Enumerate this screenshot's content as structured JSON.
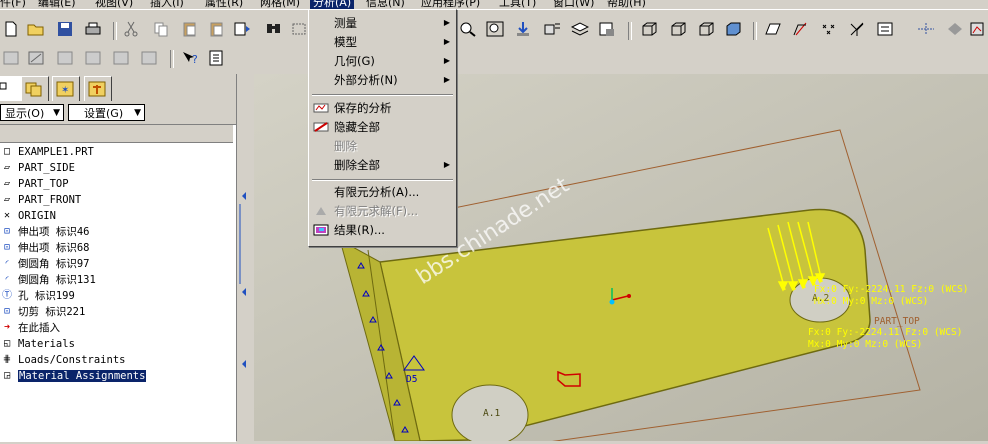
{
  "menubar": {
    "items": [
      "件(F)",
      "编辑(E)",
      "视图(V)",
      "插入(I)",
      "属性(R)",
      "网格(M)",
      "分析(A)",
      "信息(N)",
      "应用程序(P)",
      "工具(T)",
      "窗口(W)",
      "帮助(H)"
    ]
  },
  "analysis_menu": {
    "items": [
      {
        "label": "测量",
        "submenu": "▶"
      },
      {
        "label": "模型",
        "submenu": "▶"
      },
      {
        "label": "几何(G)",
        "submenu": "▶"
      },
      {
        "label": "外部分析(N)",
        "submenu": "▶"
      },
      {
        "label": "保存的分析"
      },
      {
        "label": "隐藏全部"
      },
      {
        "label": "删除"
      },
      {
        "label": "删除全部",
        "submenu": "▶"
      },
      {
        "label": "有限元分析(A)..."
      },
      {
        "label": "有限元求解(F)..."
      },
      {
        "label": "结果(R)..."
      }
    ]
  },
  "left_panel": {
    "show_button": "显示(O)",
    "settings_button": "设置(G)",
    "tree": [
      {
        "label": "EXAMPLE1.PRT",
        "icon": "part-icon"
      },
      {
        "label": "PART_SIDE",
        "icon": "datum-plane-icon"
      },
      {
        "label": "PART_TOP",
        "icon": "datum-plane-icon"
      },
      {
        "label": "PART_FRONT",
        "icon": "datum-plane-icon"
      },
      {
        "label": "ORIGIN",
        "icon": "coordinate-system-icon"
      },
      {
        "label": "伸出项 标识46",
        "icon": "extrude-icon"
      },
      {
        "label": "伸出项 标识68",
        "icon": "extrude-icon"
      },
      {
        "label": "倒圆角 标识97",
        "icon": "round-icon"
      },
      {
        "label": "倒圆角 标识131",
        "icon": "round-icon"
      },
      {
        "label": "孔 标识199",
        "icon": "hole-icon"
      },
      {
        "label": "切剪 标识221",
        "icon": "cut-icon"
      },
      {
        "label": "在此插入",
        "icon": "insert-arrow-icon"
      },
      {
        "label": "Materials",
        "icon": "materials-icon"
      },
      {
        "label": "Loads/Constraints",
        "icon": "loads-icon"
      },
      {
        "label": "Material Assignments",
        "icon": "material-assign-icon"
      }
    ]
  },
  "viewport": {
    "watermark": "bbs.chinade.net",
    "load_label_1a": "Fx:0 Fy:-2224.11 Fz:0 (WCS)",
    "load_label_1b": "Mx:0 My:0 Mz:0 (WCS)",
    "datum_label": "PART_TOP",
    "load_label_2a": "Fx:0 Fy:-2224.11 Fz:0 (WCS)",
    "load_label_2b": "Mx:0 My:0 Mz:0 (WCS)",
    "axis_label_1": "A.2",
    "axis_label_2": "A.1",
    "datum_label_2": "D5"
  },
  "colors": {
    "part_fill": "#c8c43c",
    "part_edge": "#6e6a10",
    "load_arrows": "#ffff00",
    "menu_highlight": "#0a246a"
  }
}
